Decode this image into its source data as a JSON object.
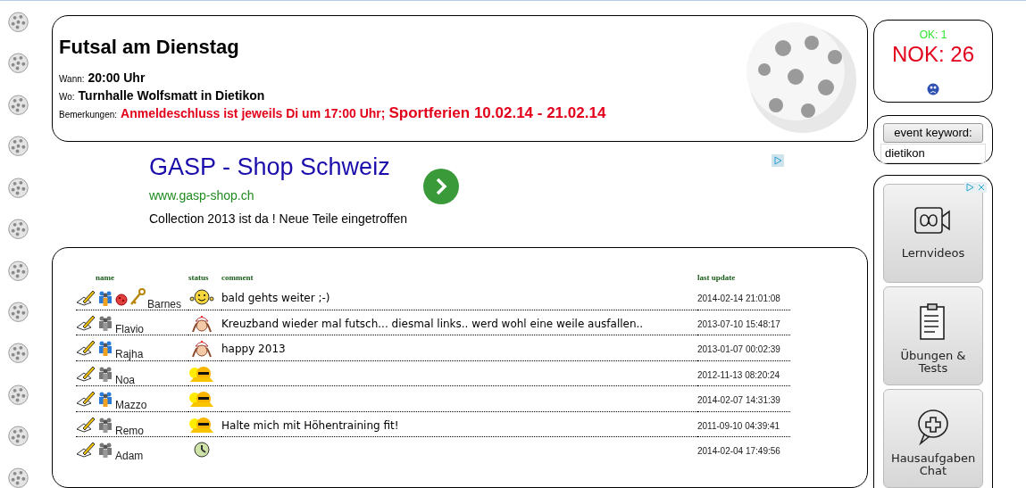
{
  "event": {
    "title": "Futsal am Dienstag",
    "details": [
      {
        "label": "Wann:",
        "value": "20:00 Uhr",
        "kind": "plain"
      },
      {
        "label": "Wo:",
        "value": "Turnhalle Wolfsmatt in Dietikon",
        "kind": "plain"
      },
      {
        "label": "Bemerkungen:",
        "value": "Anmeldeschluss ist jeweils Di um 17:00 Uhr;",
        "extra": "Sportferien 10.02.14 - 21.02.14",
        "kind": "alert"
      }
    ]
  },
  "ad": {
    "headline": "GASP - Shop Schweiz",
    "url": "www.gasp-shop.ch",
    "text": "Collection 2013 ist da ! Neue Teile eingetroffen"
  },
  "table": {
    "columns": [
      "name",
      "status",
      "comment",
      "last update"
    ],
    "rows": [
      {
        "name": "Barnes",
        "member": true,
        "roles": [
          {
            "kind": "ball"
          },
          {
            "kind": "key"
          }
        ],
        "status": {
          "kind": "smile"
        },
        "comment": "bald gehts weiter ;-)",
        "last_update": "2014-02-14 21:01:08"
      },
      {
        "name": "Flavio",
        "member": false,
        "status": {
          "kind": "nurse"
        },
        "comment": "Kreuzband wieder mal futsch... diesmal links.. werd wohl eine weile ausfallen..",
        "last_update": "2013-07-10 15:48:17"
      },
      {
        "name": "Rajha",
        "member": true,
        "status": {
          "kind": "nurse"
        },
        "comment": "happy 2013",
        "last_update": "2013-01-07 00:02:39"
      },
      {
        "name": "Noa",
        "member": false,
        "status": {
          "kind": "sun"
        },
        "last_update": "2012-11-13 08:20:24"
      },
      {
        "name": "Mazzo",
        "member": true,
        "status": {
          "kind": "sun"
        },
        "last_update": "2014-02-07 14:31:39"
      },
      {
        "name": "Remo",
        "member": false,
        "status": {
          "kind": "sun"
        },
        "comment": "Halte mich mit Höhentraining fit!",
        "last_update": "2011-09-10 04:39:41"
      },
      {
        "name": "Adam",
        "member": false,
        "status": {
          "kind": "clock"
        },
        "last_update": "2014-02-04 17:49:56"
      }
    ]
  },
  "summary": {
    "ok": "OK: 1",
    "nok": "NOK: 26"
  },
  "keyword": {
    "button": "event keyword:",
    "value": "dietikon"
  },
  "side_ad": {
    "items": [
      {
        "label": "Lernvideos",
        "kind": "video"
      },
      {
        "label": "Übungen & Tests",
        "kind": "clipboard"
      },
      {
        "label": "Hausaufgaben Chat",
        "kind": "chat"
      }
    ]
  }
}
